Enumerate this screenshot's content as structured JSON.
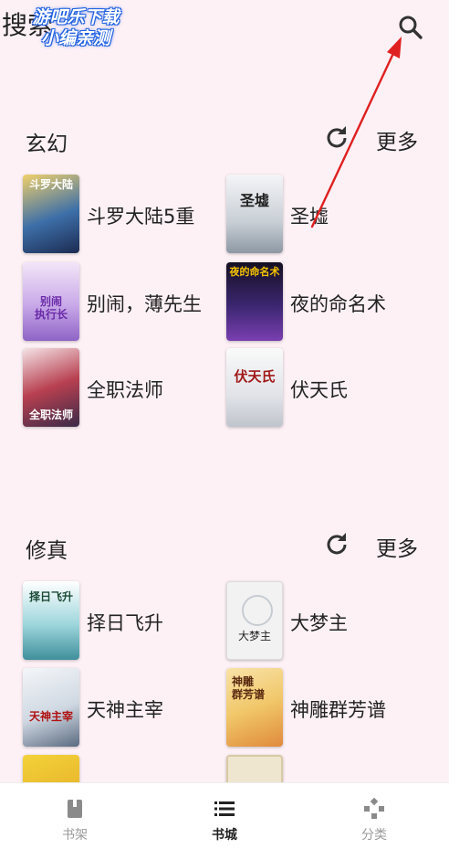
{
  "topbar": {
    "title": "搜索"
  },
  "watermark": {
    "line1": "游吧乐下载",
    "line2": "小编亲测"
  },
  "sections": [
    {
      "title": "玄幻",
      "more": "更多",
      "books": [
        {
          "name": "斗罗大陆5重",
          "cover_text": "斗罗大陆",
          "cover_color": "#3d6fa8"
        },
        {
          "name": "圣墟",
          "cover_text": "圣墟",
          "cover_color": "#d9dde2"
        },
        {
          "name": "别闹，薄先生",
          "cover_text": "别闹\n执行长",
          "cover_color": "#c8a8e8"
        },
        {
          "name": "夜的命名术",
          "cover_text": "夜的命名术",
          "cover_color": "#2a1a4a"
        },
        {
          "name": "全职法师",
          "cover_text": "全职法师",
          "cover_color": "#b84050"
        },
        {
          "name": "伏天氏",
          "cover_text": "伏天氏",
          "cover_color": "#e8e8ea"
        }
      ]
    },
    {
      "title": "修真",
      "more": "更多",
      "books": [
        {
          "name": "择日飞升",
          "cover_text": "择日飞升",
          "cover_color": "#9ed6dc"
        },
        {
          "name": "大梦主",
          "cover_text": "大梦主",
          "cover_color": "#eeeeee"
        },
        {
          "name": "天神主宰",
          "cover_text": "天神主宰",
          "cover_color": "#cfd8e2"
        },
        {
          "name": "神雕群芳谱",
          "cover_text": "神雕\n群芳谱",
          "cover_color": "#f1c76a"
        },
        {
          "name": "",
          "cover_text": "",
          "cover_color": "#f3d23a"
        },
        {
          "name": "",
          "cover_text": "",
          "cover_color": "#efe6cf"
        }
      ]
    }
  ],
  "nav": [
    {
      "label": "书架",
      "icon": "book-icon",
      "active": false
    },
    {
      "label": "书城",
      "icon": "list-icon",
      "active": true
    },
    {
      "label": "分类",
      "icon": "category-icon",
      "active": false
    }
  ],
  "colors": {
    "background": "#fdf1f6",
    "annotation_arrow": "#e02020",
    "active_nav": "#222222",
    "inactive_nav": "#9a9a9a"
  }
}
